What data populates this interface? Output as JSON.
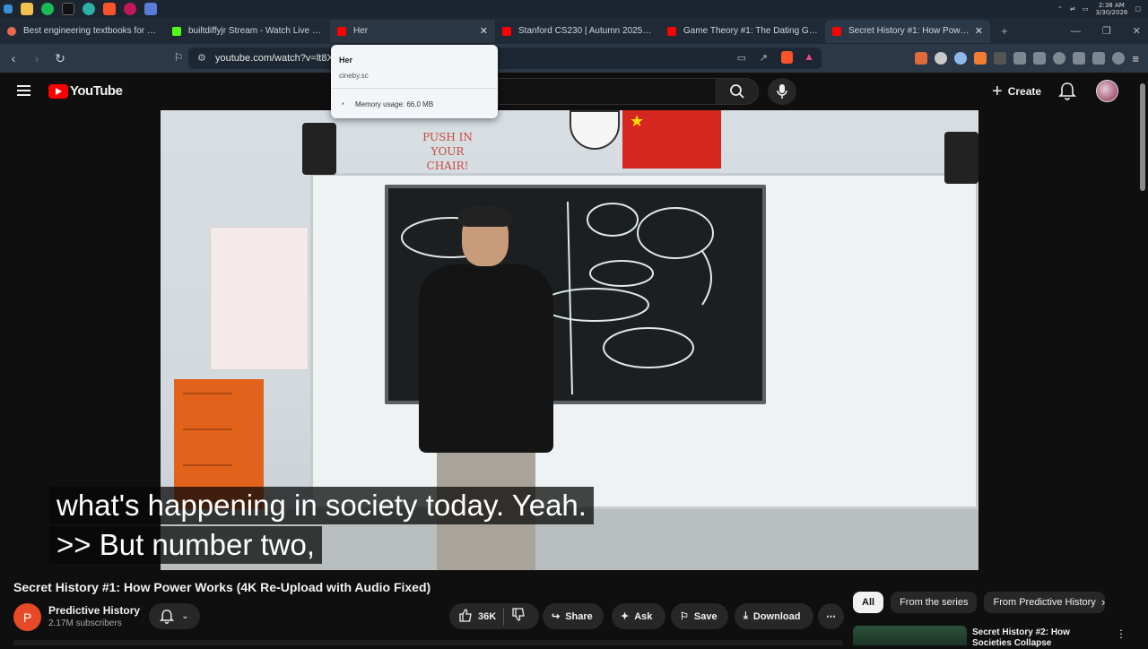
{
  "os": {
    "clock_time": "2:38 AM",
    "clock_date": "3/30/2026"
  },
  "browser": {
    "tabs": [
      {
        "label": "Best engineering textbooks for pract",
        "color": "#e8684a"
      },
      {
        "label": "builtdiffyjr Stream - Watch Live on Ki",
        "color": "#53fc18"
      },
      {
        "label": "Her",
        "color": "#ff0000"
      },
      {
        "label": "Stanford CS230 | Autumn 2025 | Lectu",
        "color": "#ff0000"
      },
      {
        "label": "Game Theory #1: The Dating Game -",
        "color": "#ff0000"
      },
      {
        "label": "Secret History #1: How Power Wo",
        "color": "#ff0000"
      }
    ],
    "url": "youtube.com/watch?v=lt8X",
    "hover_card": {
      "title": "Her",
      "domain": "cineby.sc",
      "memory": "Memory usage: 66.0 MB"
    }
  },
  "youtube": {
    "logo_text": "YouTube",
    "create_label": "Create",
    "video": {
      "caption_line1": "what's happening in society today. Yeah.",
      "caption_line2": ">> But number two,",
      "sign_text": "PUSH IN YOUR CHAIR!"
    },
    "title": "Secret History #1: How Power Works (4K Re-Upload with Audio Fixed)",
    "channel": {
      "initial": "P",
      "name": "Predictive History",
      "subscribers": "2.17M subscribers"
    },
    "actions": {
      "likes": "36K",
      "share": "Share",
      "ask": "Ask",
      "save": "Save",
      "download": "Download"
    },
    "chips": [
      "All",
      "From the series",
      "From Predictive History"
    ],
    "recommendation": {
      "title": "Secret History #2: How Societies Collapse"
    }
  }
}
